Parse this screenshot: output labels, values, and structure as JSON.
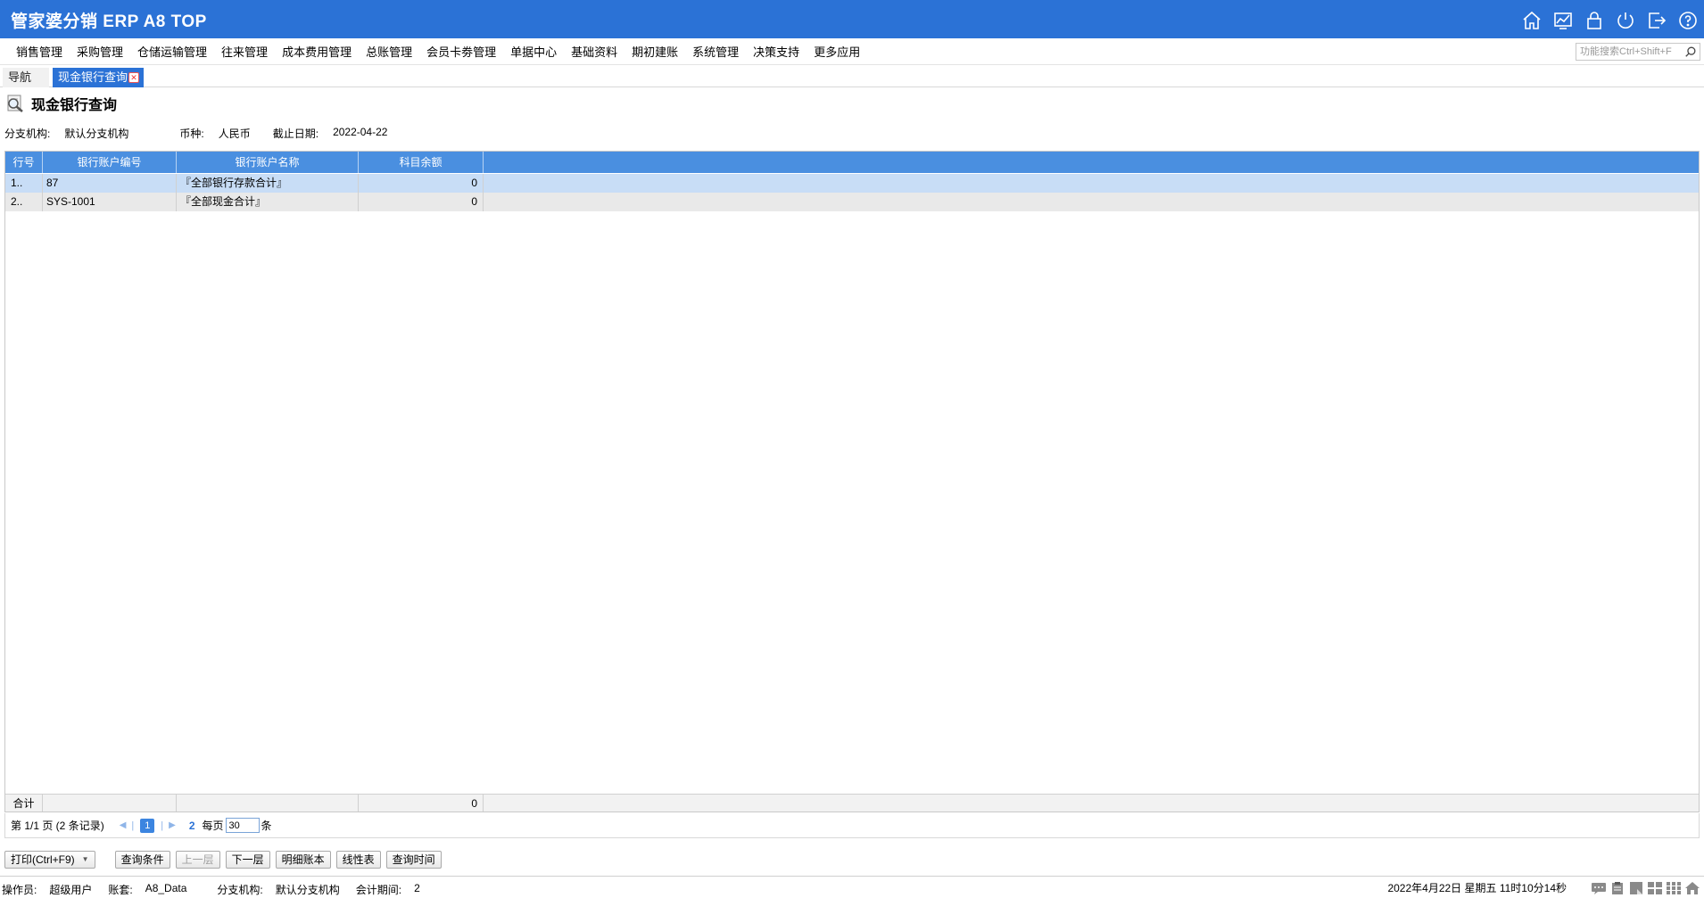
{
  "app": {
    "title": "管家婆分销 ERP A8 TOP",
    "accent_color": "#2b72d6",
    "top_icons": [
      "home-icon",
      "chart-icon",
      "lock-icon",
      "power-icon",
      "logout-icon",
      "help-icon"
    ]
  },
  "menu": {
    "items": [
      "销售管理",
      "采购管理",
      "仓储运输管理",
      "往来管理",
      "成本费用管理",
      "总账管理",
      "会员卡劵管理",
      "单据中心",
      "基础资料",
      "期初建账",
      "系统管理",
      "决策支持",
      "更多应用"
    ],
    "search_placeholder": "功能搜索Ctrl+Shift+F"
  },
  "tabs": {
    "nav_label": "导航",
    "active_label": "现金银行查询"
  },
  "page": {
    "title": "现金银行查询",
    "filters": {
      "branch_label": "分支机构:",
      "branch_value": "默认分支机构",
      "currency_label": "币种:",
      "currency_value": "人民币",
      "date_label": "截止日期:",
      "date_value": "2022-04-22"
    }
  },
  "grid": {
    "columns": [
      "行号",
      "银行账户编号",
      "银行账户名称",
      "科目余额"
    ],
    "rows": [
      {
        "row_no": "1..",
        "code": "87",
        "name": "『全部银行存款合计』",
        "balance": "0"
      },
      {
        "row_no": "2..",
        "code": "SYS-1001",
        "name": "『全部现金合计』",
        "balance": "0"
      }
    ],
    "footer": {
      "label": "合计",
      "balance": "0"
    }
  },
  "pager": {
    "page_info": "第  1/1 页  (2 条记录)",
    "current_page": "1",
    "next_page": "2",
    "per_page_label": "每页",
    "per_page_value": "30",
    "unit": "条"
  },
  "buttons": {
    "print": "打印(Ctrl+F9)",
    "query_conditions": "查询条件",
    "up_level": "上一层",
    "down_level": "下一层",
    "detail_ledger": "明细账本",
    "line_chart": "线性表",
    "query_time": "查询时间"
  },
  "status": {
    "operator_label": "操作员:",
    "operator_value": "超级用户",
    "account_label": "账套:",
    "account_value": "A8_Data",
    "branch_label": "分支机构:",
    "branch_value": "默认分支机构",
    "period_label": "会计期间:",
    "period_value": "2",
    "datetime": "2022年4月22日  星期五  11时10分14秒"
  }
}
